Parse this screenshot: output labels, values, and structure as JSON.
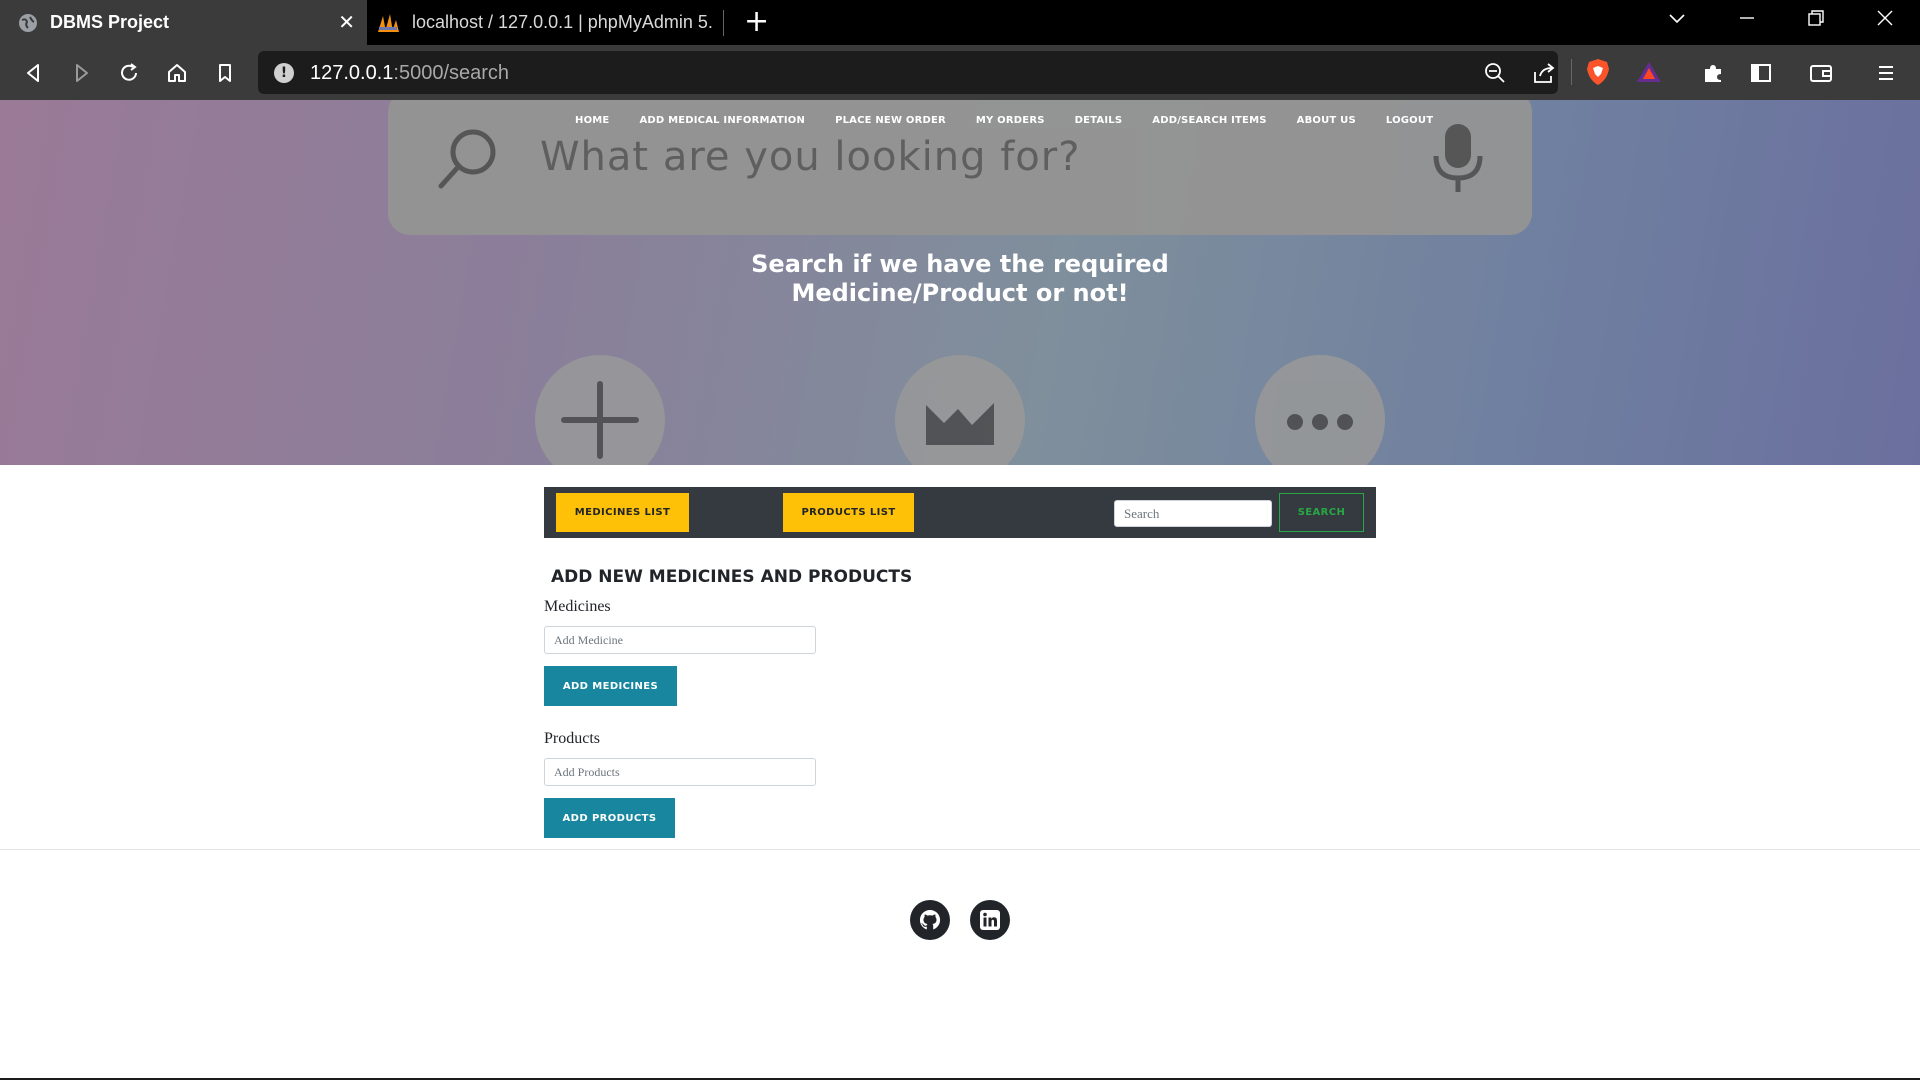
{
  "browser": {
    "tabs": [
      {
        "title": "DBMS Project",
        "active": true
      },
      {
        "title": "localhost / 127.0.0.1 | phpMyAdmin 5.",
        "active": false
      }
    ],
    "url": {
      "host": "127.0.0.1",
      "path": ":5000/search"
    }
  },
  "nav": {
    "links": [
      "HOME",
      "ADD MEDICAL INFORMATION",
      "PLACE NEW ORDER",
      "MY ORDERS",
      "DETAILS",
      "ADD/SEARCH ITEMS",
      "ABOUT US",
      "LOGOUT"
    ]
  },
  "hero": {
    "search_placeholder": "What are you looking for?",
    "heading_line1": "Search if we have the required",
    "heading_line2": "Medicine/Product or not!",
    "icons": [
      "plus-icon",
      "crown-icon",
      "more-icon"
    ]
  },
  "listbar": {
    "medicines_list_label": "MEDICINES LIST",
    "products_list_label": "PRODUCTS LIST",
    "search_placeholder": "Search",
    "search_button_label": "SEARCH"
  },
  "add_section": {
    "heading": "ADD NEW MEDICINES AND PRODUCTS",
    "medicines_label": "Medicines",
    "medicines_placeholder": "Add Medicine",
    "medicines_button": "ADD MEDICINES",
    "products_label": "Products",
    "products_placeholder": "Add Products",
    "products_button": "ADD PRODUCTS"
  },
  "footer": {
    "icons": [
      "github-icon",
      "linkedin-icon"
    ]
  },
  "colors": {
    "yellow": "#ffc107",
    "teal": "#17869e",
    "dark_bar": "#343a40",
    "success": "#28a745"
  }
}
